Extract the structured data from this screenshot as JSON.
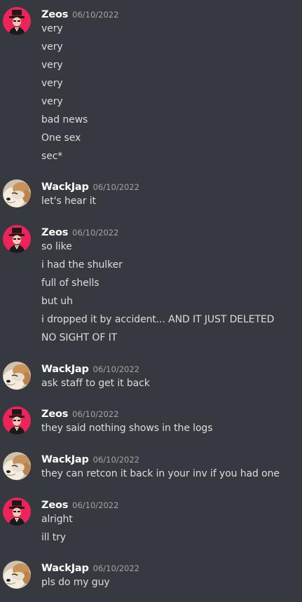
{
  "messages": [
    {
      "author": "Zeos",
      "avatar": "zeos-avatar",
      "timestamp": "06/10/2022",
      "lines": [
        "very",
        "very",
        "very",
        "very",
        "very",
        "bad news",
        "One sex",
        "sec*"
      ]
    },
    {
      "author": "WackJap",
      "avatar": "wackjap-avatar",
      "timestamp": "06/10/2022",
      "lines": [
        "let's hear it"
      ]
    },
    {
      "author": "Zeos",
      "avatar": "zeos-avatar",
      "timestamp": "06/10/2022",
      "lines": [
        "so like",
        "i had the shulker",
        "full of shells",
        "but uh",
        "i dropped it by accident... AND IT JUST DELETED",
        "NO SIGHT OF IT"
      ]
    },
    {
      "author": "WackJap",
      "avatar": "wackjap-avatar",
      "timestamp": "06/10/2022",
      "lines": [
        "ask staff to get it back"
      ]
    },
    {
      "author": "Zeos",
      "avatar": "zeos-avatar",
      "timestamp": "06/10/2022",
      "lines": [
        "they said nothing shows in the logs"
      ]
    },
    {
      "author": "WackJap",
      "avatar": "wackjap-avatar",
      "timestamp": "06/10/2022",
      "lines": [
        "they can retcon it back in your inv if you had one"
      ]
    },
    {
      "author": "Zeos",
      "avatar": "zeos-avatar",
      "timestamp": "06/10/2022",
      "lines": [
        "alright",
        "ill try"
      ]
    },
    {
      "author": "WackJap",
      "avatar": "wackjap-avatar",
      "timestamp": "06/10/2022",
      "lines": [
        "pls do my guy"
      ]
    }
  ],
  "colors": {
    "background": "#36393f",
    "username": "#ffffff",
    "text": "#dcddde",
    "timestamp": "#a3a6aa",
    "zeos_avatar_bg": "#ed245a"
  }
}
